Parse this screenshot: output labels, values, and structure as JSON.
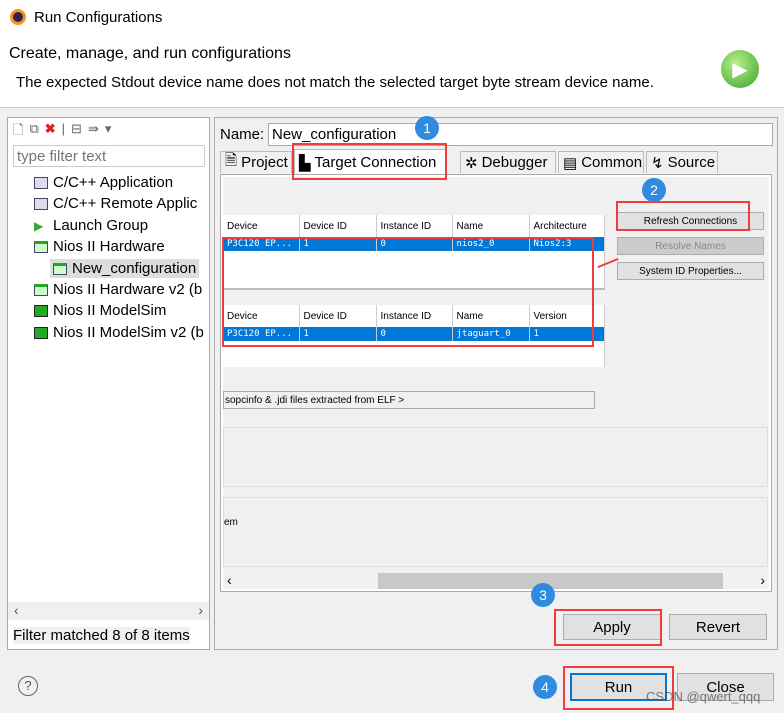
{
  "window": {
    "title": "Run Configurations"
  },
  "header": {
    "title": "Create, manage, and run configurations",
    "message": "The expected Stdout device name does not match the selected target byte stream device name."
  },
  "sidebar": {
    "filter_placeholder": "type filter text",
    "items": [
      {
        "label": "C/C++ Application",
        "icon": "c-app-icon"
      },
      {
        "label": "C/C++ Remote Applic",
        "icon": "c-app-icon"
      },
      {
        "label": "Launch Group",
        "icon": "launch-group-icon"
      },
      {
        "label": "Nios II Hardware",
        "icon": "nios-hardware-icon"
      },
      {
        "label": "New_configuration",
        "icon": "nios-hardware-icon",
        "selected": true
      },
      {
        "label": "Nios II Hardware v2 (b",
        "icon": "nios-hardware-icon"
      },
      {
        "label": "Nios II ModelSim",
        "icon": "modelsim-icon"
      },
      {
        "label": "Nios II ModelSim v2 (b",
        "icon": "modelsim-icon"
      }
    ],
    "status": "Filter matched 8 of 8 items"
  },
  "form": {
    "name_label": "Name:",
    "name_value": "New_configuration",
    "tabs": [
      {
        "label": "Project"
      },
      {
        "label": "Target Connection",
        "active": true
      },
      {
        "label": "Debugger"
      },
      {
        "label": "Common"
      },
      {
        "label": "Source"
      }
    ],
    "processors": {
      "columns": [
        "Device",
        "Device ID",
        "Instance ID",
        "Name",
        "Architecture"
      ],
      "row": [
        "P3C120",
        "EP...",
        "1",
        "0",
        "nios2_0",
        "Nios2:3"
      ]
    },
    "byte_stream": {
      "columns": [
        "Device",
        "Device ID",
        "Instance ID",
        "Name",
        "Version"
      ],
      "row": [
        "P3C120",
        "EP...",
        "1",
        "0",
        "jtaguart_0",
        "1"
      ]
    },
    "refresh_connections": "Refresh Connections",
    "resolve_names": "Resolve Names",
    "system_id_properties": "System ID Properties...",
    "sopcinfo_text": "sopcinfo & .jdi files extracted from ELF >",
    "truncated_label": "em",
    "apply": "Apply",
    "revert": "Revert"
  },
  "footer": {
    "run": "Run",
    "close": "Close",
    "help_icon": "help-icon"
  },
  "annotations": [
    "1",
    "2",
    "3",
    "4"
  ],
  "watermark": "CSDN @qwert_qqq",
  "colors": {
    "selection": "#0078d7",
    "annotation_box": "#f03c3c",
    "badge": "#2f8be0"
  }
}
